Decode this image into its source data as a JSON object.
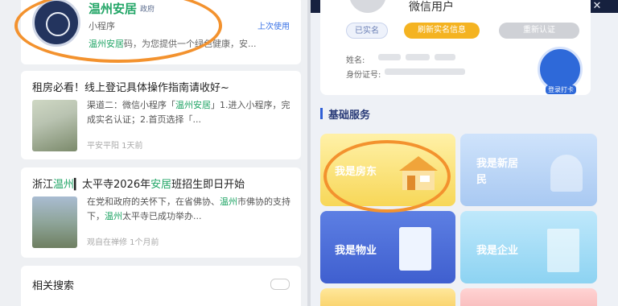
{
  "left": {
    "result1": {
      "brand": "温州安居",
      "brand_tag": "政府",
      "type": "小程序",
      "last_used": "上次使用",
      "desc_hl": "温州安居",
      "desc_rest": "码，为您提供一个绿色健康，安..."
    },
    "article1": {
      "title": "租房必看！线上登记具体操作指南请收好~",
      "body_pre": "渠道二：微信小程序「",
      "body_hl": "温州安居",
      "body_post": "」1.进入小程序，完成实名认证；2.首页选择「...",
      "meta": "平安平阳 1天前"
    },
    "article2": {
      "title_pre": "浙江",
      "title_hl1": "温州",
      "title_mid": "▎太平寺2026年",
      "title_hl2": "安居",
      "title_post": "班招生即日开始",
      "body_pre": "在党和政府的关怀下，在省佛协、",
      "body_hl1": "温州",
      "body_mid": "市佛协的支持下，",
      "body_hl2": "温州",
      "body_post": "太平寺已成功举办...",
      "meta": "观自在禅修 1个月前"
    },
    "related": {
      "title": "相关搜索"
    }
  },
  "right": {
    "close_glyph": "✕",
    "profile": {
      "username": "微信用户",
      "badge_verified": "已实名",
      "badge_refresh": "刷新实名信息",
      "badge_reauth": "重新认证",
      "name_label": "姓名:",
      "id_label": "身份证号:",
      "sport_label": "登录打卡"
    },
    "section_title": "基础服务",
    "tiles": [
      {
        "label": "我是房东"
      },
      {
        "label": "我是新居民"
      },
      {
        "label": "我是物业"
      },
      {
        "label": "我是企业"
      }
    ]
  },
  "colors": {
    "brand_green": "#21a566",
    "highlight_orange": "#f3922e",
    "accent_blue": "#2f5fd6",
    "badge_yellow": "#f4b321"
  }
}
